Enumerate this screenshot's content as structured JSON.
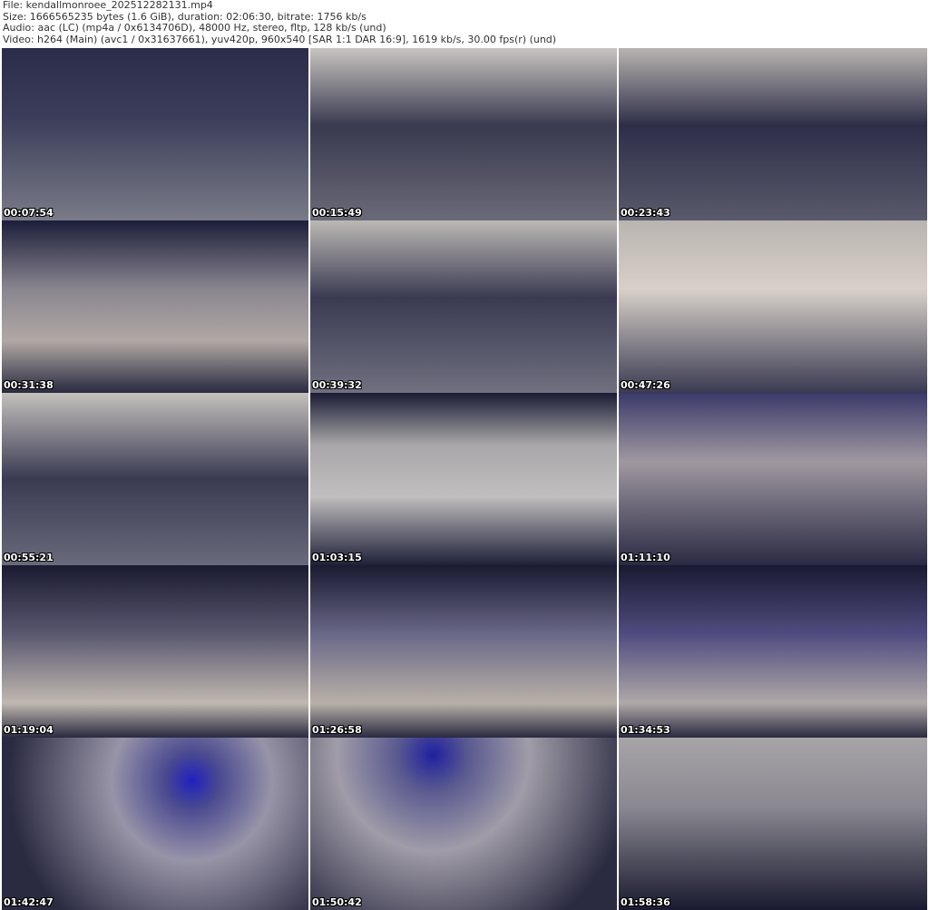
{
  "header": {
    "file": "File: kendallmonroee_202512282131.mp4",
    "size": "Size: 1666565235 bytes (1.6 GiB), duration: 02:06:30, bitrate: 1756 kb/s",
    "audio": "Audio: aac (LC) (mp4a / 0x6134706D), 48000 Hz, stereo, fltp, 128 kb/s (und)",
    "video": "Video: h264 (Main) (avc1 / 0x31637661), yuv420p, 960x540 [SAR 1:1 DAR 16:9], 1619 kb/s, 30.00 fps(r) (und)"
  },
  "thumbnails": [
    {
      "timestamp": "00:07:54"
    },
    {
      "timestamp": "00:15:49"
    },
    {
      "timestamp": "00:23:43"
    },
    {
      "timestamp": "00:31:38"
    },
    {
      "timestamp": "00:39:32"
    },
    {
      "timestamp": "00:47:26"
    },
    {
      "timestamp": "00:55:21"
    },
    {
      "timestamp": "01:03:15"
    },
    {
      "timestamp": "01:11:10"
    },
    {
      "timestamp": "01:19:04"
    },
    {
      "timestamp": "01:26:58"
    },
    {
      "timestamp": "01:34:53"
    },
    {
      "timestamp": "01:42:47"
    },
    {
      "timestamp": "01:50:42"
    },
    {
      "timestamp": "01:58:36"
    }
  ]
}
